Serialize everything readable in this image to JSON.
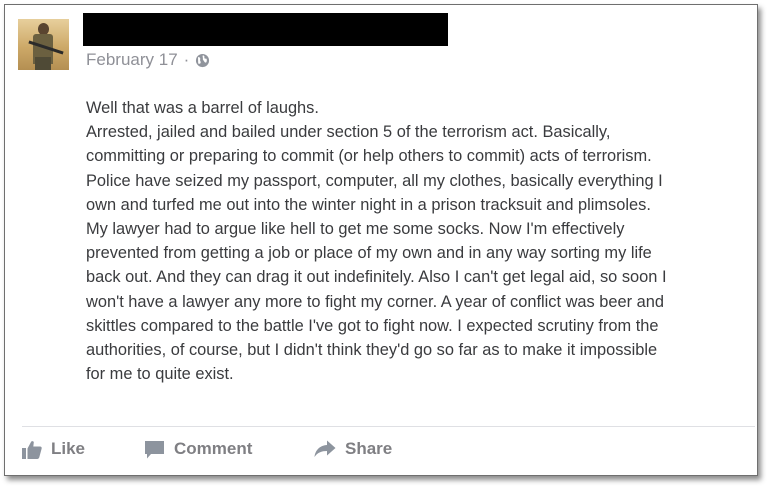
{
  "post": {
    "date": "February 17",
    "separator": "·",
    "privacy_icon": "globe-icon",
    "lines": [
      "Well that was a barrel of laughs.",
      "Arrested, jailed and bailed under section 5 of the terrorism act. Basically,",
      "committing or preparing to commit (or help others to commit) acts of terrorism.",
      "Police have seized my passport, computer, all my clothes, basically everything I",
      "own and turfed me out into the winter night in a prison tracksuit and plimsoles.",
      "My lawyer had to argue like hell to get me some socks. Now I'm effectively",
      "prevented from getting a job or place of my own and in any way sorting my life",
      "back out. And they can drag it out indefinitely. Also I can't get legal aid, so soon I",
      "won't have a lawyer any more to fight my corner. A year of conflict was beer and",
      "skittles compared to the battle I've got to fight now. I expected scrutiny from the",
      "authorities, of course, but I didn't think they'd go so far as to make it impossible",
      "for me to quite exist."
    ]
  },
  "actions": {
    "like": {
      "label": "Like",
      "icon": "thumbs-up-icon"
    },
    "comment": {
      "label": "Comment",
      "icon": "comment-icon"
    },
    "share": {
      "label": "Share",
      "icon": "share-arrow-icon"
    }
  },
  "colors": {
    "text": "#3a3b3e",
    "meta": "#8f9097",
    "action": "#7f7f83",
    "redaction": "#000000"
  }
}
